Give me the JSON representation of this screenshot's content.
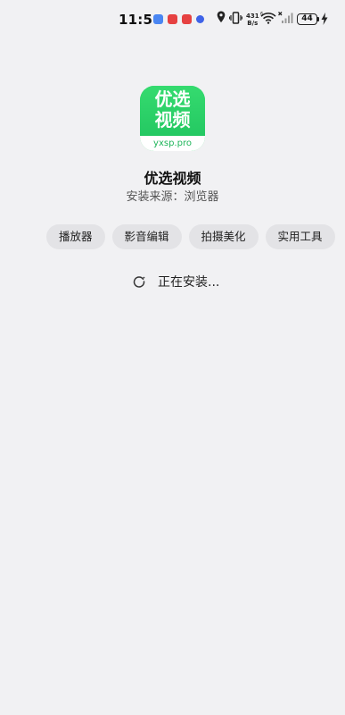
{
  "status_bar": {
    "time": "11:56",
    "net_speed_value": "431",
    "net_speed_unit": "B/s",
    "battery_level": "44"
  },
  "app": {
    "icon_line1": "优选",
    "icon_line2": "视频",
    "icon_domain": "yxsp.pro",
    "name": "优选视频",
    "source": "安装来源：浏览器"
  },
  "tags": [
    "播放器",
    "影音编辑",
    "拍摄美化",
    "实用工具"
  ],
  "install": {
    "status": "正在安装..."
  },
  "colors": {
    "background": "#f1f1f3",
    "icon_green": "#2ed36a",
    "tag_bg": "#e3e3e6"
  }
}
